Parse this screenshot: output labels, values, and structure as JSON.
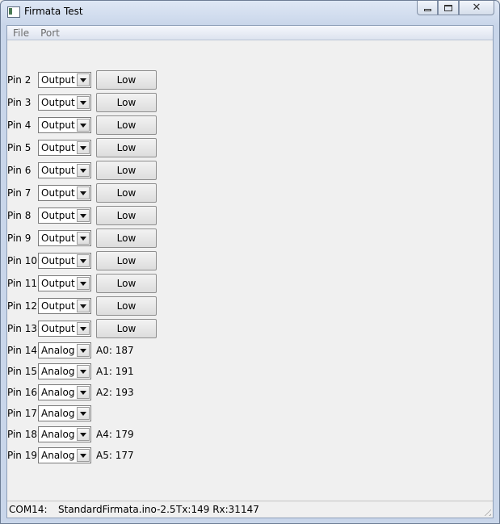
{
  "window": {
    "title": "Firmata Test"
  },
  "menu": {
    "file": "File",
    "port": "Port"
  },
  "output_pins": [
    {
      "label": "Pin 2",
      "mode": "Output",
      "button": "Low"
    },
    {
      "label": "Pin 3",
      "mode": "Output",
      "button": "Low"
    },
    {
      "label": "Pin 4",
      "mode": "Output",
      "button": "Low"
    },
    {
      "label": "Pin 5",
      "mode": "Output",
      "button": "Low"
    },
    {
      "label": "Pin 6",
      "mode": "Output",
      "button": "Low"
    },
    {
      "label": "Pin 7",
      "mode": "Output",
      "button": "Low"
    },
    {
      "label": "Pin 8",
      "mode": "Output",
      "button": "Low"
    },
    {
      "label": "Pin 9",
      "mode": "Output",
      "button": "Low"
    },
    {
      "label": "Pin 10",
      "mode": "Output",
      "button": "Low"
    },
    {
      "label": "Pin 11",
      "mode": "Output",
      "button": "Low"
    },
    {
      "label": "Pin 12",
      "mode": "Output",
      "button": "Low"
    },
    {
      "label": "Pin 13",
      "mode": "Output",
      "button": "Low"
    }
  ],
  "analog_pins": [
    {
      "label": "Pin 14",
      "mode": "Analog",
      "value": "A0: 187"
    },
    {
      "label": "Pin 15",
      "mode": "Analog",
      "value": "A1: 191"
    },
    {
      "label": "Pin 16",
      "mode": "Analog",
      "value": "A2: 193"
    },
    {
      "label": "Pin 17",
      "mode": "Analog",
      "value": ""
    },
    {
      "label": "Pin 18",
      "mode": "Analog",
      "value": "A4: 179"
    },
    {
      "label": "Pin 19",
      "mode": "Analog",
      "value": "A5: 177"
    }
  ],
  "status": {
    "port": "COM14:",
    "firmware": "StandardFirmata.ino-2.5",
    "counters": "Tx:149 Rx:31147"
  }
}
